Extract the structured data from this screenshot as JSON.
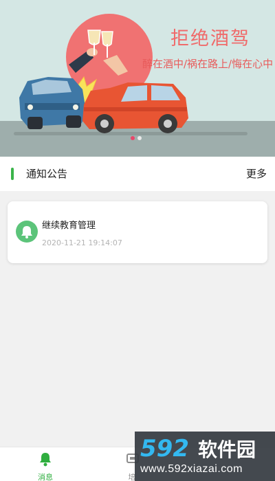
{
  "banner": {
    "headline": "拒绝酒驾",
    "slogan": "醉在酒中/祸在路上/悔在心中",
    "carousel": {
      "total": 2,
      "active_index": 0
    }
  },
  "notice": {
    "title": "通知公告",
    "more_label": "更多",
    "items": [
      {
        "title": "继续教育管理",
        "time": "2020-11-21 19:14:07",
        "icon": "bell-icon"
      }
    ]
  },
  "tabbar": {
    "tabs": [
      {
        "label": "消息",
        "icon": "bell-icon",
        "active": true
      },
      {
        "label": "培",
        "icon": "training-icon",
        "active": false
      }
    ]
  },
  "watermark": {
    "logo": "592软件园",
    "url": "www.592xiazai.com"
  },
  "colors": {
    "accent_green": "#3bb44a",
    "banner_red": "#f06a6a",
    "dot_active": "#e8476a"
  }
}
